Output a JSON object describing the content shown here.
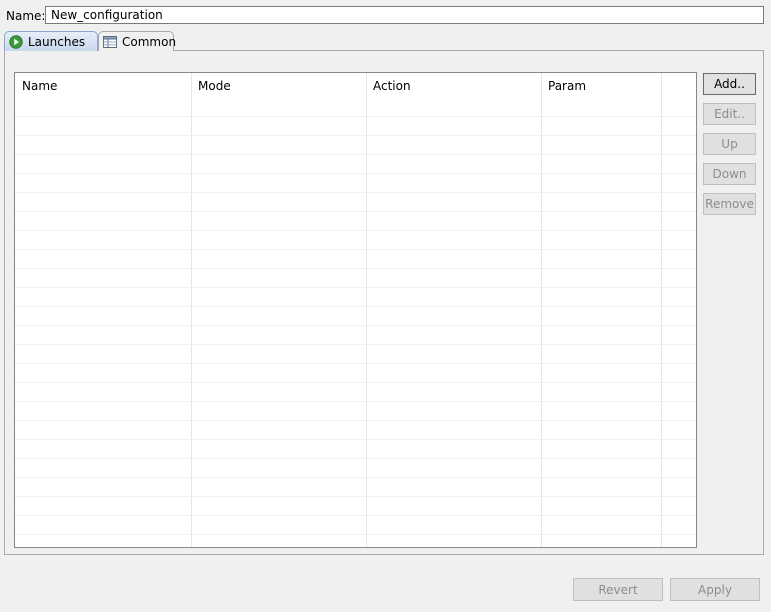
{
  "name_field": {
    "label": "Name:",
    "value": "New_configuration"
  },
  "tabs": [
    {
      "label": "Launches",
      "icon": "run-icon",
      "active": true
    },
    {
      "label": "Common",
      "icon": "table-icon",
      "active": false
    }
  ],
  "table": {
    "columns": [
      "Name",
      "Mode",
      "Action",
      "Param"
    ],
    "rows": []
  },
  "side_buttons": {
    "add": "Add..",
    "edit": "Edit..",
    "up": "Up",
    "down": "Down",
    "remove": "Remove"
  },
  "footer": {
    "revert": "Revert",
    "apply": "Apply"
  },
  "colors": {
    "active_tab": "#c8d8ee",
    "run_icon": "#3a9a3a",
    "disabled_text": "#8d8d8d"
  }
}
